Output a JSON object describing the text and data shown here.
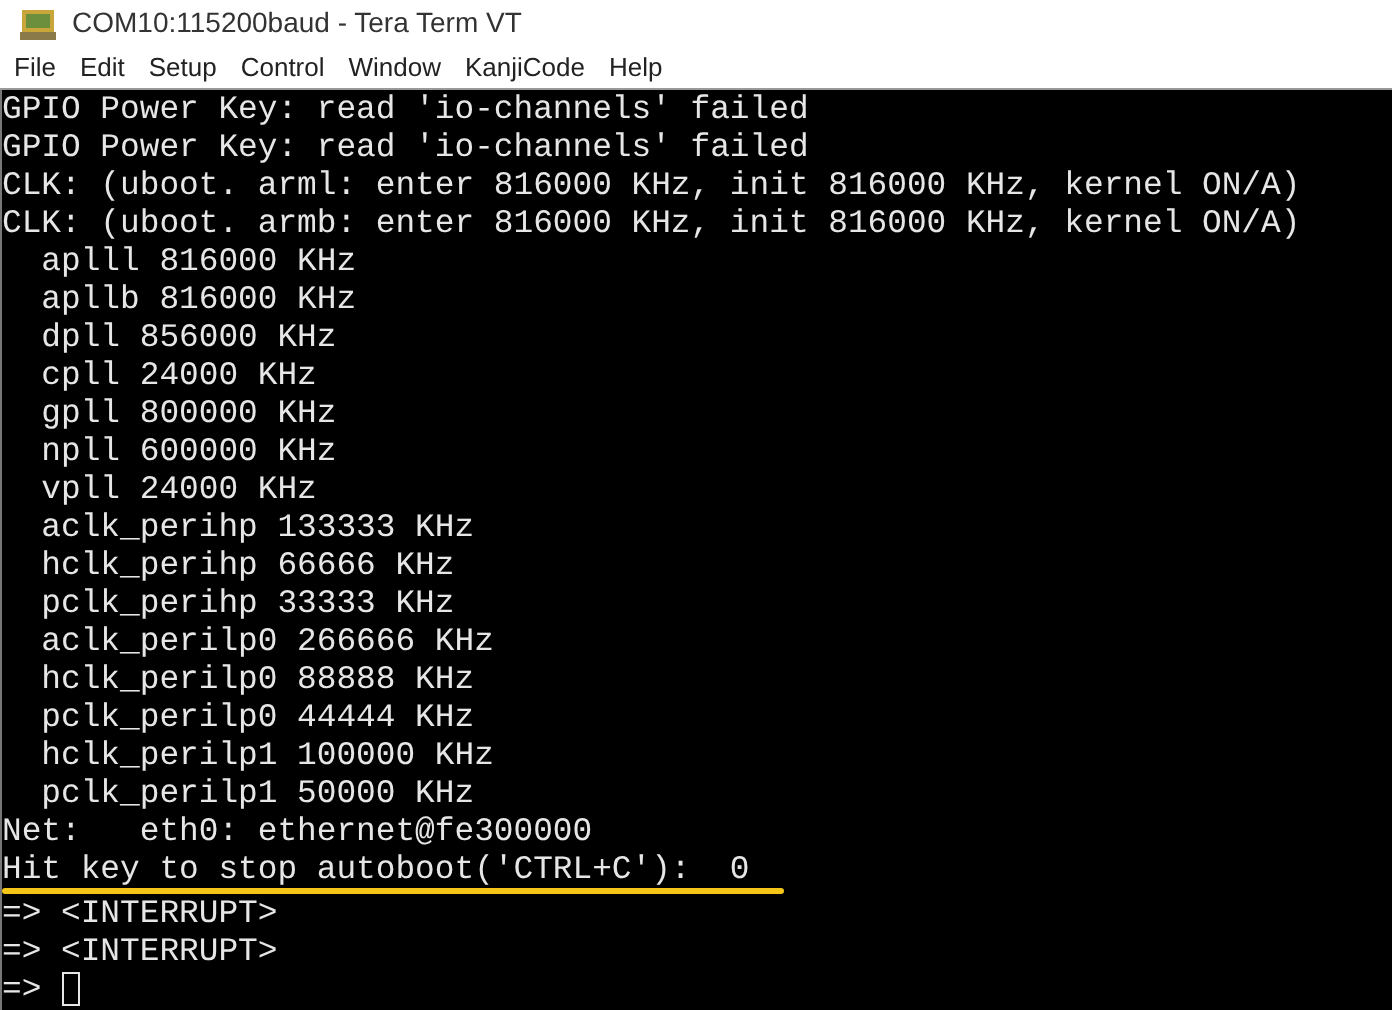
{
  "window": {
    "title": "COM10:115200baud - Tera Term VT"
  },
  "menu": [
    "File",
    "Edit",
    "Setup",
    "Control",
    "Window",
    "KanjiCode",
    "Help"
  ],
  "terminal": {
    "lines": [
      {
        "text": "GPIO Power Key: read 'io-channels' failed",
        "underlined": false
      },
      {
        "text": "GPIO Power Key: read 'io-channels' failed",
        "underlined": false
      },
      {
        "text": "CLK: (uboot. arml: enter 816000 KHz, init 816000 KHz, kernel ON/A)",
        "underlined": false
      },
      {
        "text": "CLK: (uboot. armb: enter 816000 KHz, init 816000 KHz, kernel ON/A)",
        "underlined": false
      },
      {
        "text": "  aplll 816000 KHz",
        "underlined": false
      },
      {
        "text": "  apllb 816000 KHz",
        "underlined": false
      },
      {
        "text": "  dpll 856000 KHz",
        "underlined": false
      },
      {
        "text": "  cpll 24000 KHz",
        "underlined": false
      },
      {
        "text": "  gpll 800000 KHz",
        "underlined": false
      },
      {
        "text": "  npll 600000 KHz",
        "underlined": false
      },
      {
        "text": "  vpll 24000 KHz",
        "underlined": false
      },
      {
        "text": "  aclk_perihp 133333 KHz",
        "underlined": false
      },
      {
        "text": "  hclk_perihp 66666 KHz",
        "underlined": false
      },
      {
        "text": "  pclk_perihp 33333 KHz",
        "underlined": false
      },
      {
        "text": "  aclk_perilp0 266666 KHz",
        "underlined": false
      },
      {
        "text": "  hclk_perilp0 88888 KHz",
        "underlined": false
      },
      {
        "text": "  pclk_perilp0 44444 KHz",
        "underlined": false
      },
      {
        "text": "  hclk_perilp1 100000 KHz",
        "underlined": false
      },
      {
        "text": "  pclk_perilp1 50000 KHz",
        "underlined": false
      },
      {
        "text": "Net:   eth0: ethernet@fe300000",
        "underlined": false
      },
      {
        "text": "Hit key to stop autoboot('CTRL+C'):  0",
        "underlined": true
      },
      {
        "text": "=> <INTERRUPT>",
        "underlined": false
      },
      {
        "text": "=> <INTERRUPT>",
        "underlined": false
      }
    ],
    "prompt": "=>"
  }
}
